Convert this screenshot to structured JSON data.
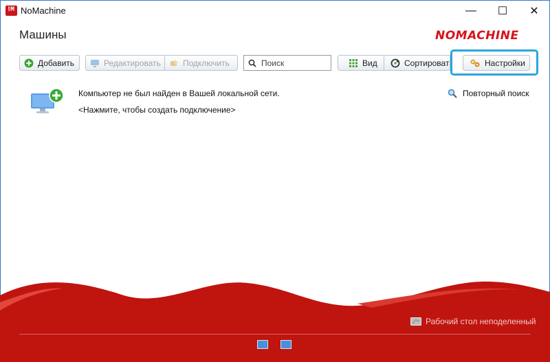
{
  "window": {
    "title": "NoMachine",
    "minimize_glyph": "—",
    "maximize_glyph": "☐",
    "close_glyph": "✕"
  },
  "header": {
    "page_title": "Машины",
    "brand": "NOMACHINE"
  },
  "toolbar": {
    "add_label": "Добавить",
    "edit_label": "Редактировать",
    "connect_label": "Подключить",
    "search_placeholder": "Поиск",
    "view_label": "Вид",
    "sort_label": "Сортироват",
    "settings_label": "Настройки"
  },
  "content": {
    "not_found_message": "Компьютер не был найден в Вашей локальной сети.",
    "create_connection_link": "<Нажмите, чтобы создать подключение>",
    "rescan_label": "Повторный поиск"
  },
  "footer": {
    "desktop_status": "Рабочий стол неподеленный"
  },
  "colors": {
    "brand_red": "#c8171d",
    "highlight": "#2aa7d8",
    "add_green": "#3aa935"
  }
}
